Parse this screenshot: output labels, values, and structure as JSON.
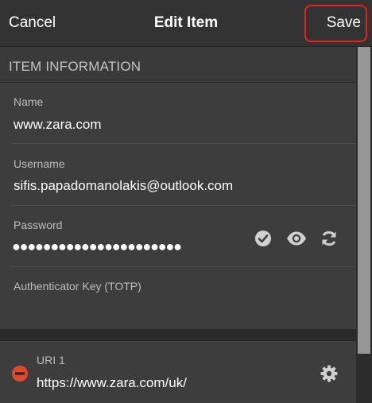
{
  "header": {
    "cancel_label": "Cancel",
    "title": "Edit Item",
    "save_label": "Save"
  },
  "section": {
    "title": "ITEM INFORMATION"
  },
  "fields": {
    "name": {
      "label": "Name",
      "value": "www.zara.com"
    },
    "username": {
      "label": "Username",
      "value": "sifis.papadomanolakis@outlook.com"
    },
    "password": {
      "label": "Password",
      "masked_value": "●●●●●●●●●●●●●●●●●●●●●●"
    },
    "totp": {
      "label": "Authenticator Key (TOTP)"
    }
  },
  "uri": {
    "label": "URI 1",
    "value": "https://www.zara.com/uk/"
  },
  "icons": {
    "check": "check-circle-icon",
    "eye": "eye-icon",
    "refresh": "refresh-icon",
    "remove": "remove-circle-icon",
    "gear": "gear-icon"
  },
  "colors": {
    "highlight": "#e8221b",
    "remove": "#e0492c"
  }
}
